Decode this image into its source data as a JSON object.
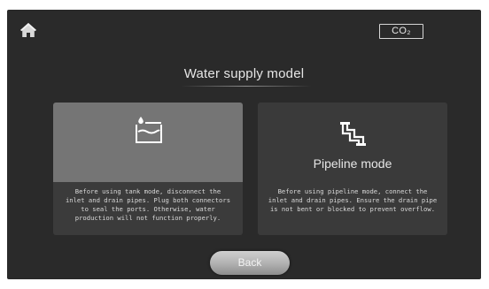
{
  "header": {
    "home_icon": "home-icon",
    "co2_label": "CO₂"
  },
  "title": "Water supply model",
  "cards": [
    {
      "id": "tank",
      "icon": "water-tank-icon",
      "label": "",
      "selected": true,
      "description": [
        "Before using tank mode, disconnect the",
        "inlet and drain pipes. Plug both connectors",
        "to seal the ports. Otherwise, water",
        "production will not function properly."
      ]
    },
    {
      "id": "pipeline",
      "icon": "pipeline-icon",
      "label": "Pipeline mode",
      "selected": false,
      "description": [
        "Before using pipeline mode, connect the",
        "inlet and drain pipes. Ensure the drain pipe",
        "is not bent or blocked to prevent overflow."
      ]
    }
  ],
  "back_label": "Back",
  "colors": {
    "screen_bg": "#2a2a2a",
    "selected_card": "#757575",
    "card_bg": "#3a3a3a",
    "text": "#e6e6e6"
  }
}
